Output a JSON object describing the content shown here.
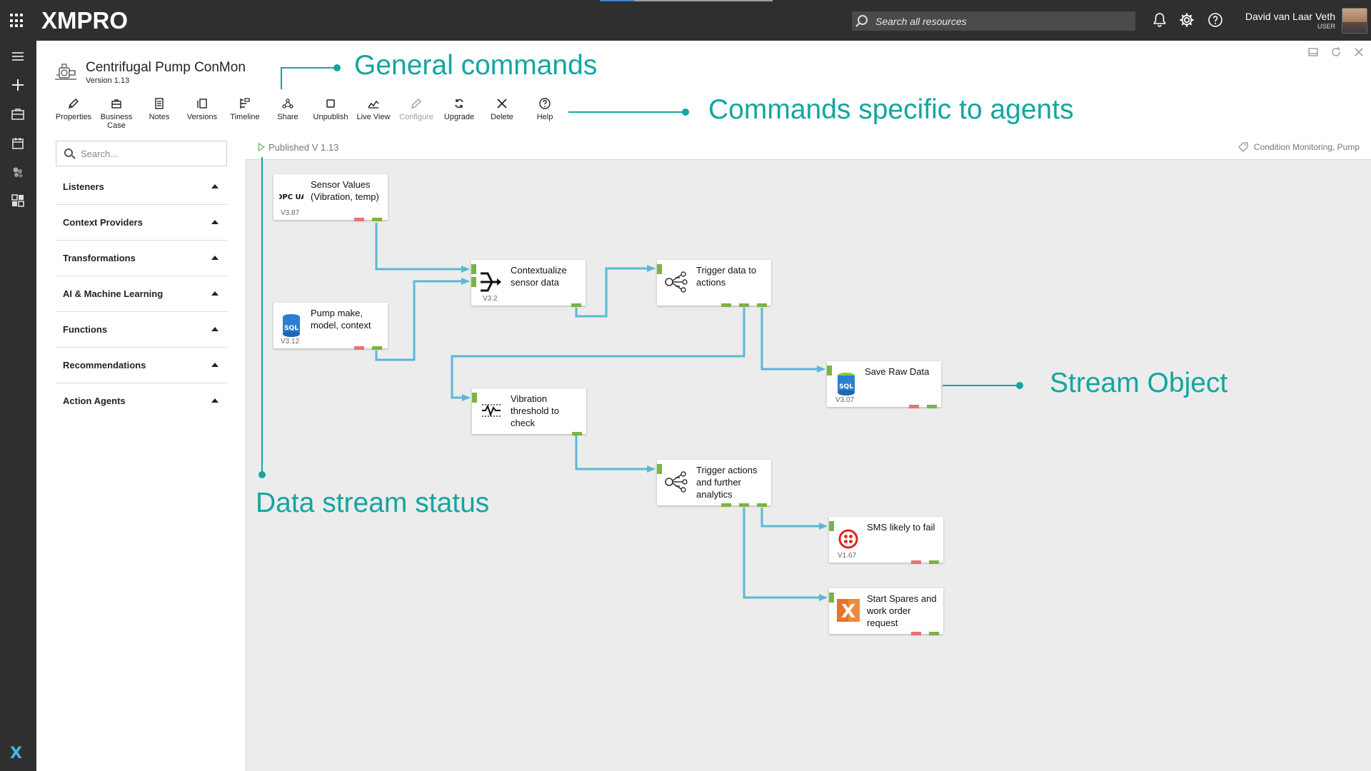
{
  "topbar": {
    "logo_text": "XMPRO",
    "search_placeholder": "Search all resources",
    "user_name": "David van Laar Veth",
    "user_role": "USER",
    "icons": [
      "apps-grid-icon",
      "bell-icon",
      "gear-icon",
      "help-icon"
    ]
  },
  "leftrail": {
    "icons": [
      "menu-icon",
      "plus-icon",
      "briefcase-icon",
      "calendar-icon",
      "agents-icon",
      "dashboard-icon"
    ],
    "bottom_logo": "X"
  },
  "app": {
    "title": "Centrifugal Pump ConMon",
    "version": "Version 1.13"
  },
  "toolbar": {
    "properties": "Properties",
    "business_case": "Business Case",
    "notes": "Notes",
    "versions": "Versions",
    "timeline": "Timeline",
    "share": "Share",
    "unpublish": "Unpublish",
    "live_view": "Live View",
    "configure": "Configure",
    "upgrade": "Upgrade",
    "delete": "Delete",
    "help": "Help"
  },
  "sidebar": {
    "search_placeholder": "Search...",
    "categories": [
      {
        "label": "Listeners"
      },
      {
        "label": "Context Providers"
      },
      {
        "label": "Transformations"
      },
      {
        "label": "AI & Machine Learning"
      },
      {
        "label": "Functions"
      },
      {
        "label": "Recommendations"
      },
      {
        "label": "Action Agents"
      }
    ]
  },
  "status": {
    "published": "Published V 1.13",
    "tags": "Condition Monitoring, Pump"
  },
  "nodes": {
    "sensor": {
      "label": "Sensor Values (Vibration, temp)",
      "version": "V3.87",
      "icon": "opc-ua-icon"
    },
    "pump": {
      "label": "Pump make, model, context",
      "version": "V3.12",
      "icon": "sql-icon"
    },
    "contextualize": {
      "label": "Contextualize sensor data",
      "version": "V3.2",
      "icon": "join-icon"
    },
    "trigger1": {
      "label": "Trigger data to actions",
      "version": "",
      "icon": "broadcast-icon"
    },
    "save": {
      "label": "Save Raw Data",
      "version": "V3.07",
      "icon": "sql-icon"
    },
    "vibration": {
      "label": "Vibration threshold to check",
      "version": "",
      "icon": "threshold-icon"
    },
    "trigger2": {
      "label": "Trigger actions and further analytics",
      "version": "",
      "icon": "broadcast-icon"
    },
    "sms": {
      "label": "SMS likely to fail",
      "version": "V1.67",
      "icon": "twilio-icon"
    },
    "spares": {
      "label": "Start Spares and work order request",
      "version": "",
      "icon": "xmpro-x-icon"
    }
  },
  "annotations": {
    "general": "General commands",
    "agents": "Commands specific to agents",
    "stream": "Stream Object",
    "status": "Data stream status"
  },
  "colors": {
    "annotation": "#14a5a0",
    "wire": "#5bb8d4",
    "port_ok": "#7cb342",
    "port_err": "#e57373",
    "topbar": "#2f2f2f"
  }
}
